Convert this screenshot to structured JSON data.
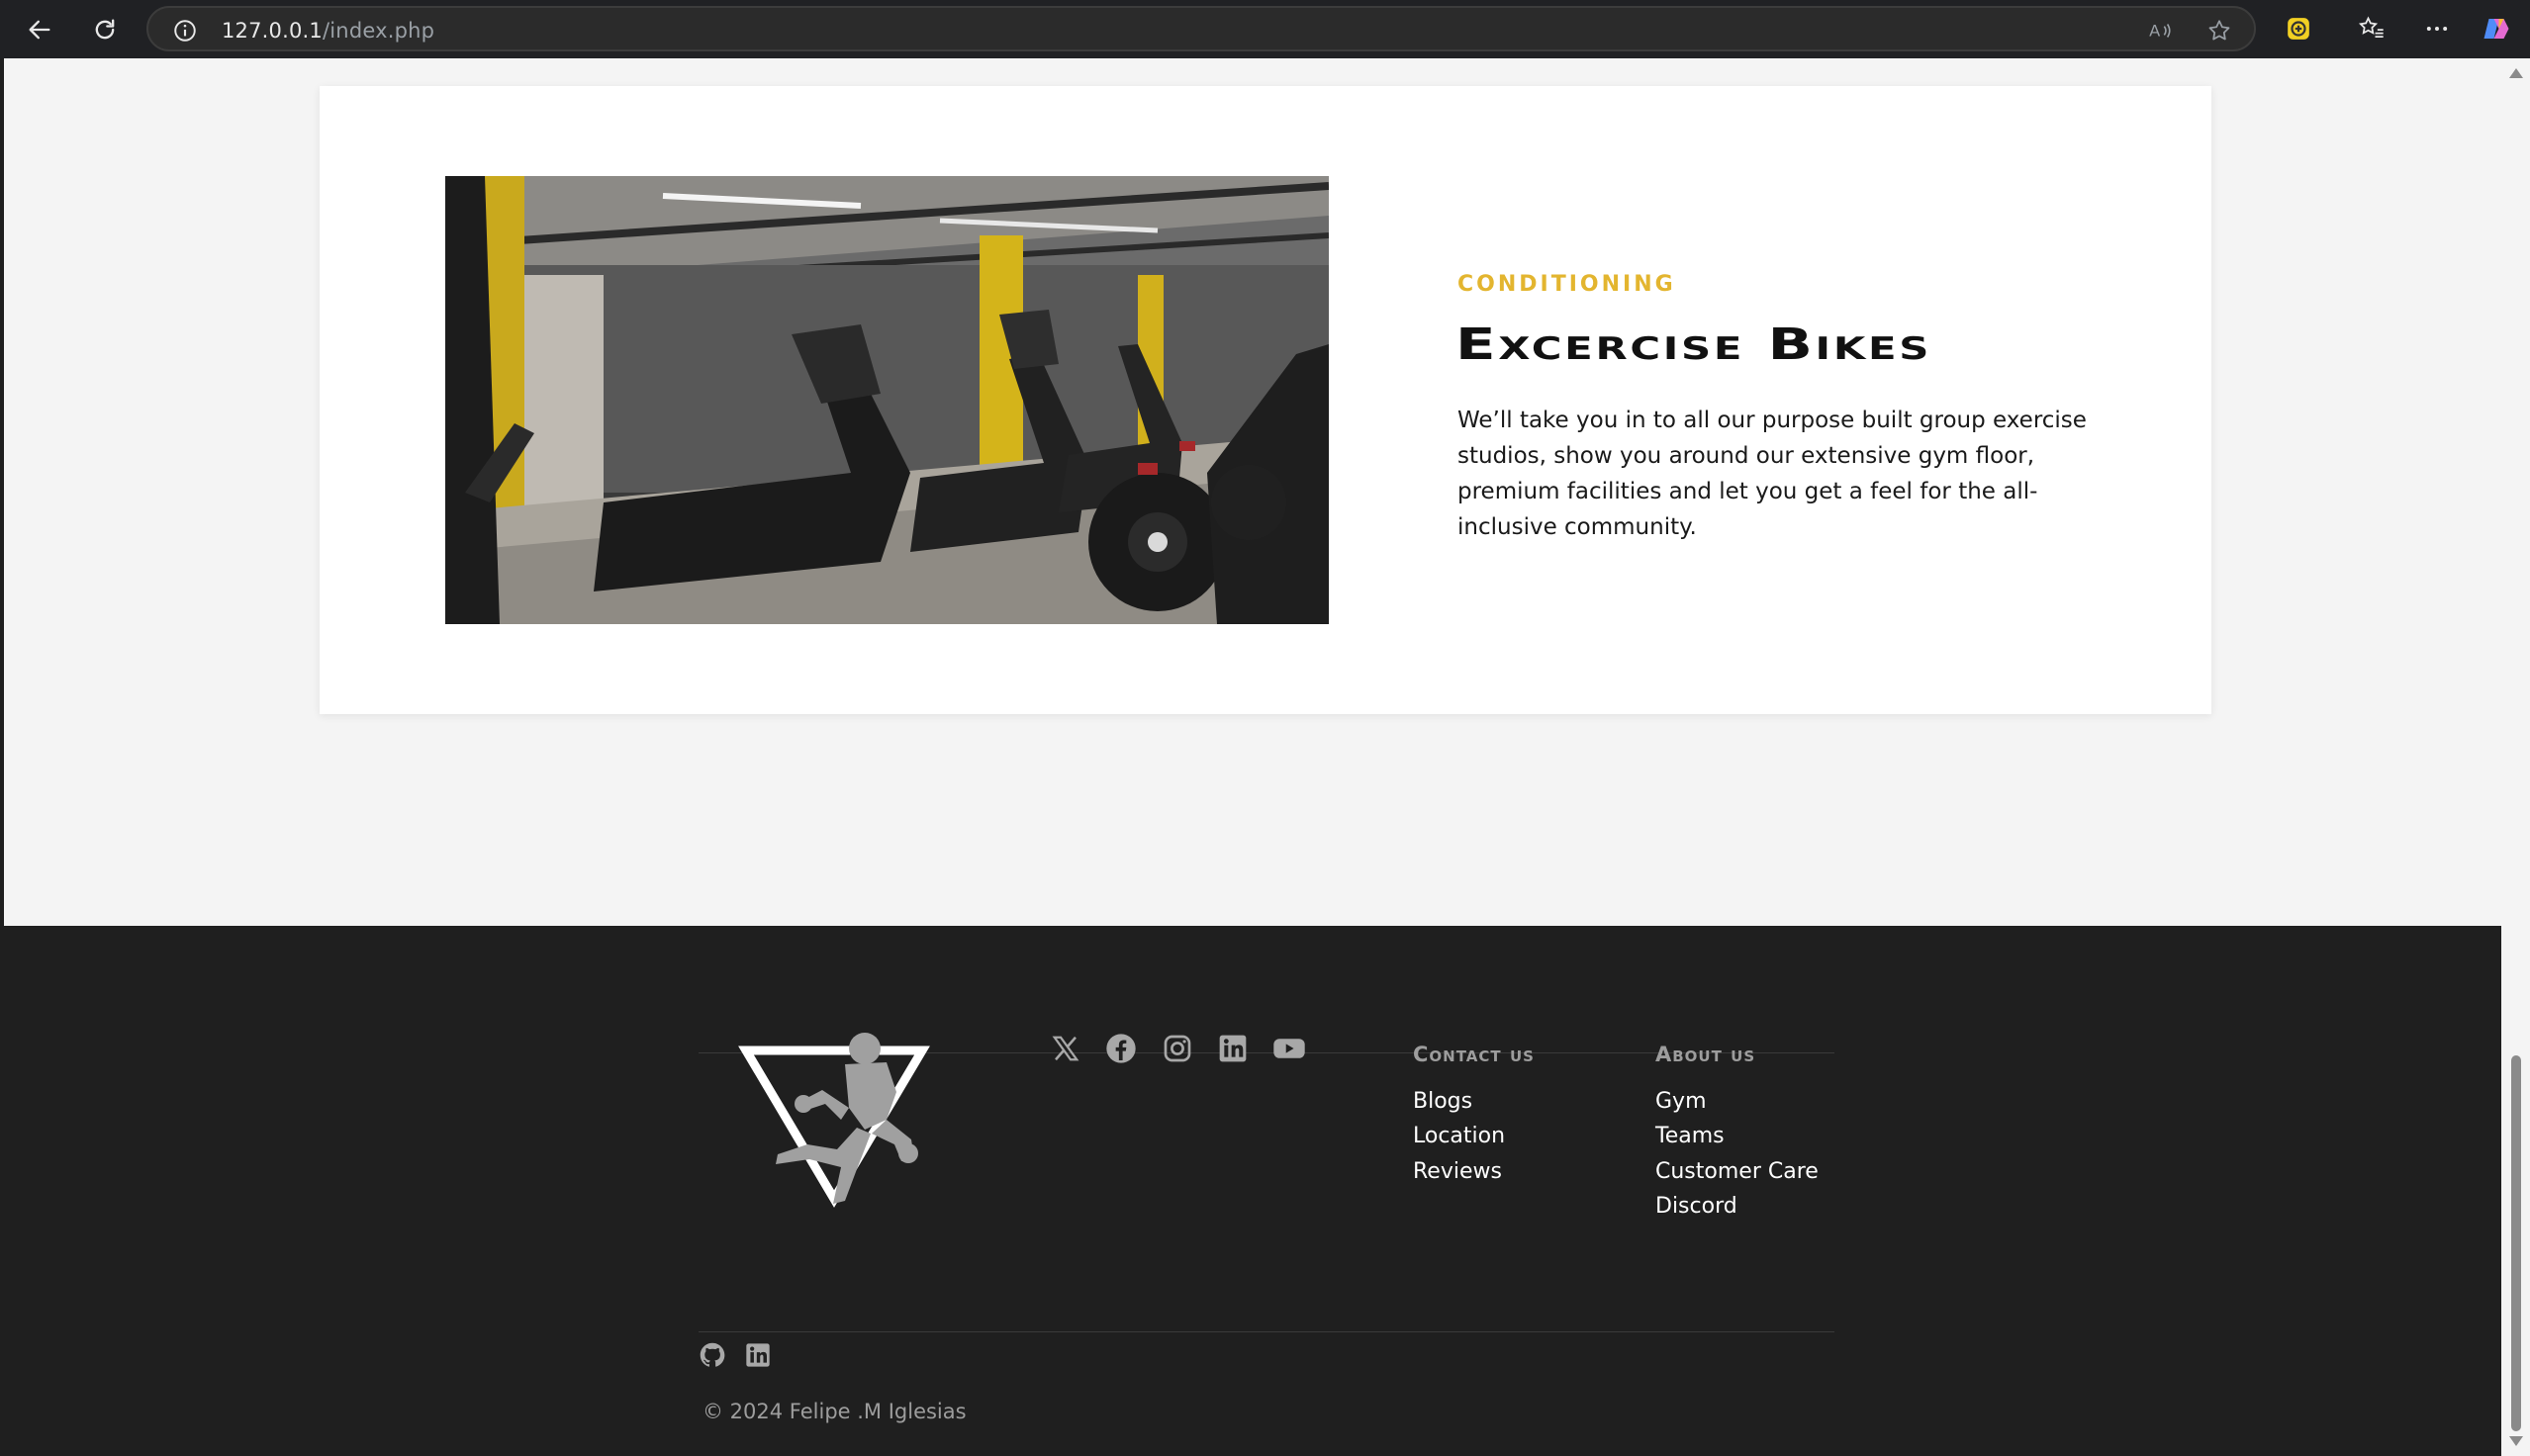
{
  "browser": {
    "url_host": "127.0.0.1",
    "url_path": "/index.php"
  },
  "card": {
    "eyebrow": "CONDITIONING",
    "title": "Excercise Bikes",
    "body": "We’ll take you in to all our purpose built group exercise studios, show you around our extensive gym floor, premium facilities and let you get a feel for the all-inclusive community.",
    "accent_color": "#e3b52f"
  },
  "footer": {
    "social_icons": [
      "x-icon",
      "facebook-icon",
      "instagram-icon",
      "linkedin-icon",
      "youtube-icon"
    ],
    "contact": {
      "heading": "Contact us",
      "links": [
        "Blogs",
        "Location",
        "Reviews"
      ]
    },
    "about": {
      "heading": "About us",
      "links": [
        "Gym",
        "Teams",
        "Customer Care",
        "Discord"
      ]
    },
    "bottom_icons": [
      "github-icon",
      "linkedin-icon"
    ],
    "copyright": "© 2024 Felipe .M Iglesias"
  }
}
